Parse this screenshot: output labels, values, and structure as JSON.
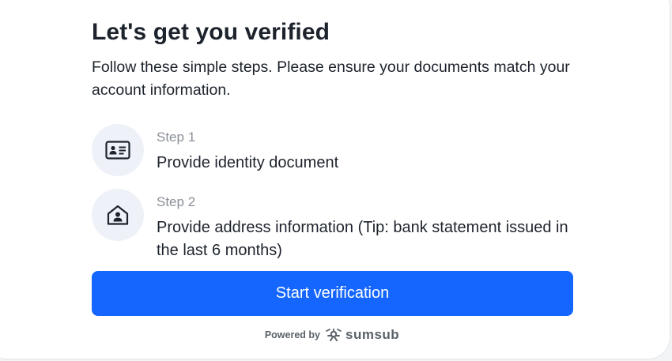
{
  "header": {
    "title": "Let's get you verified",
    "subtitle": "Follow these simple steps. Please ensure your documents match your account information."
  },
  "steps": [
    {
      "label": "Step 1",
      "description": "Provide identity document",
      "icon": "id-card-icon"
    },
    {
      "label": "Step 2",
      "description": "Provide address information (Tip: bank statement issued in the last 6 months)",
      "icon": "home-person-icon"
    }
  ],
  "actions": {
    "start_label": "Start verification"
  },
  "footer": {
    "powered_by": "Powered by",
    "brand": "sumsub"
  },
  "colors": {
    "primary": "#1466ff",
    "icon_bg": "#eef1f8",
    "text": "#1d232c",
    "muted": "#8a8f98"
  }
}
